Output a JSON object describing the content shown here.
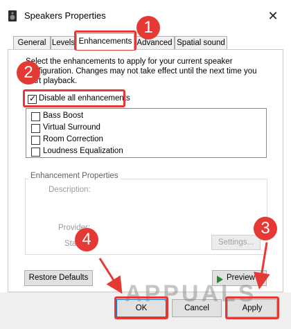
{
  "window": {
    "title": "Speakers Properties",
    "close_glyph": "✕"
  },
  "tabs": [
    {
      "label": "General"
    },
    {
      "label": "Levels"
    },
    {
      "label": "Enhancements"
    },
    {
      "label": "Advanced"
    },
    {
      "label": "Spatial sound"
    }
  ],
  "active_tab": "Enhancements",
  "intro": "Select the enhancements to apply for your current speaker configuration. Changes may not take effect until the next time you start playback.",
  "disable_all": {
    "label": "Disable all enhancements",
    "checked": true
  },
  "enhancements": [
    {
      "label": "Bass Boost",
      "checked": false
    },
    {
      "label": "Virtual Surround",
      "checked": false
    },
    {
      "label": "Room Correction",
      "checked": false
    },
    {
      "label": "Loudness Equalization",
      "checked": false
    }
  ],
  "enhancement_properties": {
    "group_label": "Enhancement Properties",
    "description_label": "Description:",
    "provider_label": "Provider:",
    "status_label": "Status:",
    "settings_button": "Settings..."
  },
  "buttons": {
    "restore_defaults": "Restore Defaults",
    "preview": "Preview",
    "ok": "OK",
    "cancel": "Cancel",
    "apply": "Apply"
  },
  "annotations": {
    "step1": "1",
    "step2": "2",
    "step3": "3",
    "step4": "4",
    "color": "#e53935"
  },
  "watermark": "APPUALS"
}
